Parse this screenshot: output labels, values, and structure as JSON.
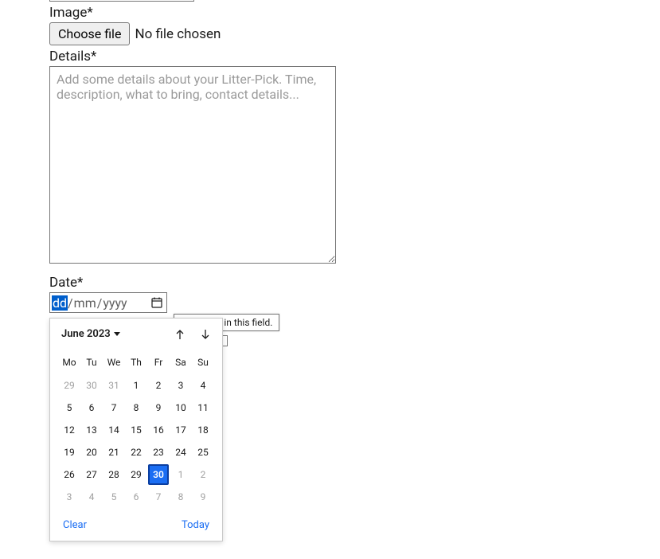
{
  "form": {
    "image": {
      "label": "Image*",
      "choose_file_label": "Choose file",
      "no_file_text": "No file chosen"
    },
    "details": {
      "label": "Details*",
      "placeholder": "Add some details about your Litter-Pick. Time, description, what to bring, contact details..."
    },
    "date": {
      "label": "Date*",
      "seg_day": "dd",
      "seg_month": "mm",
      "seg_year": "yyyy",
      "validation_tooltip": "Please fill in this field."
    }
  },
  "calendar": {
    "month_label": "June 2023",
    "dow": [
      "Mo",
      "Tu",
      "We",
      "Th",
      "Fr",
      "Sa",
      "Su"
    ],
    "weeks": [
      [
        {
          "d": "29",
          "other": true
        },
        {
          "d": "30",
          "other": true
        },
        {
          "d": "31",
          "other": true
        },
        {
          "d": "1"
        },
        {
          "d": "2"
        },
        {
          "d": "3"
        },
        {
          "d": "4"
        }
      ],
      [
        {
          "d": "5"
        },
        {
          "d": "6"
        },
        {
          "d": "7"
        },
        {
          "d": "8"
        },
        {
          "d": "9"
        },
        {
          "d": "10"
        },
        {
          "d": "11"
        }
      ],
      [
        {
          "d": "12"
        },
        {
          "d": "13"
        },
        {
          "d": "14"
        },
        {
          "d": "15"
        },
        {
          "d": "16"
        },
        {
          "d": "17"
        },
        {
          "d": "18"
        }
      ],
      [
        {
          "d": "19"
        },
        {
          "d": "20"
        },
        {
          "d": "21"
        },
        {
          "d": "22"
        },
        {
          "d": "23"
        },
        {
          "d": "24"
        },
        {
          "d": "25"
        }
      ],
      [
        {
          "d": "26"
        },
        {
          "d": "27"
        },
        {
          "d": "28"
        },
        {
          "d": "29"
        },
        {
          "d": "30",
          "today": true
        },
        {
          "d": "1",
          "other": true
        },
        {
          "d": "2",
          "other": true
        }
      ],
      [
        {
          "d": "3",
          "other": true
        },
        {
          "d": "4",
          "other": true
        },
        {
          "d": "5",
          "other": true
        },
        {
          "d": "6",
          "other": true
        },
        {
          "d": "7",
          "other": true
        },
        {
          "d": "8",
          "other": true
        },
        {
          "d": "9",
          "other": true
        }
      ]
    ],
    "clear_label": "Clear",
    "today_label": "Today"
  }
}
